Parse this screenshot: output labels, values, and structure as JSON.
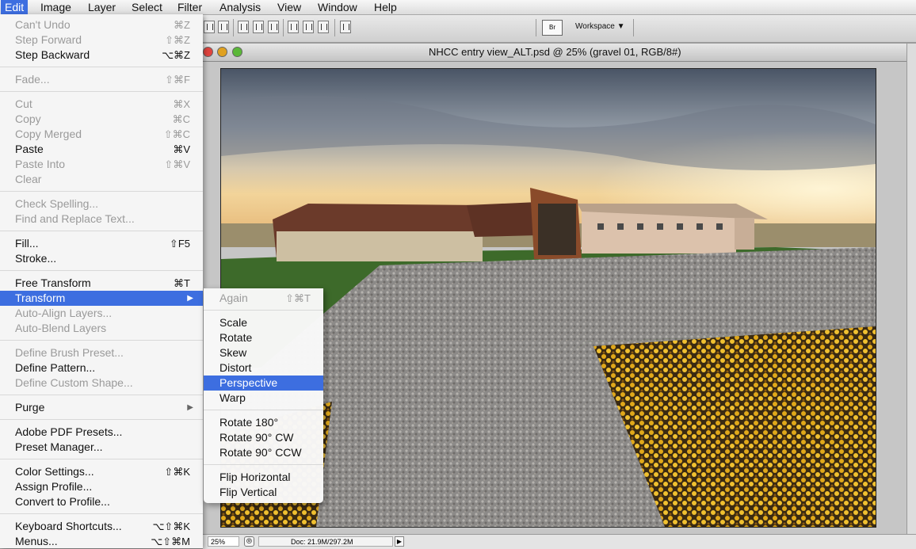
{
  "menubar": {
    "items": [
      "Edit",
      "Image",
      "Layer",
      "Select",
      "Filter",
      "Analysis",
      "View",
      "Window",
      "Help"
    ]
  },
  "toolbar": {
    "bridge_label": "Br",
    "workspace_label": "Workspace ▼"
  },
  "document": {
    "title": "NHCC entry view_ALT.psd @ 25% (gravel 01, RGB/8#)",
    "zoom": "25%",
    "doc_info": "Doc: 21.9M/297.2M"
  },
  "edit_menu": {
    "items": [
      {
        "label": "Can't Undo",
        "shortcut": "⌘Z",
        "disabled": true
      },
      {
        "label": "Step Forward",
        "shortcut": "⇧⌘Z",
        "disabled": true
      },
      {
        "label": "Step Backward",
        "shortcut": "⌥⌘Z",
        "disabled": false
      },
      {
        "label": "Fade...",
        "shortcut": "⇧⌘F",
        "disabled": true
      },
      {
        "label": "Cut",
        "shortcut": "⌘X",
        "disabled": true
      },
      {
        "label": "Copy",
        "shortcut": "⌘C",
        "disabled": true
      },
      {
        "label": "Copy Merged",
        "shortcut": "⇧⌘C",
        "disabled": true
      },
      {
        "label": "Paste",
        "shortcut": "⌘V",
        "disabled": false
      },
      {
        "label": "Paste Into",
        "shortcut": "⇧⌘V",
        "disabled": true
      },
      {
        "label": "Clear",
        "shortcut": "",
        "disabled": true
      },
      {
        "label": "Check Spelling...",
        "shortcut": "",
        "disabled": true
      },
      {
        "label": "Find and Replace Text...",
        "shortcut": "",
        "disabled": true
      },
      {
        "label": "Fill...",
        "shortcut": "⇧F5",
        "disabled": false
      },
      {
        "label": "Stroke...",
        "shortcut": "",
        "disabled": false
      },
      {
        "label": "Free Transform",
        "shortcut": "⌘T",
        "disabled": false
      },
      {
        "label": "Transform",
        "shortcut": "",
        "disabled": false
      },
      {
        "label": "Auto-Align Layers...",
        "shortcut": "",
        "disabled": true
      },
      {
        "label": "Auto-Blend Layers",
        "shortcut": "",
        "disabled": true
      },
      {
        "label": "Define Brush Preset...",
        "shortcut": "",
        "disabled": true
      },
      {
        "label": "Define Pattern...",
        "shortcut": "",
        "disabled": false
      },
      {
        "label": "Define Custom Shape...",
        "shortcut": "",
        "disabled": true
      },
      {
        "label": "Purge",
        "shortcut": "",
        "disabled": false
      },
      {
        "label": "Adobe PDF Presets...",
        "shortcut": "",
        "disabled": false
      },
      {
        "label": "Preset Manager...",
        "shortcut": "",
        "disabled": false
      },
      {
        "label": "Color Settings...",
        "shortcut": "⇧⌘K",
        "disabled": false
      },
      {
        "label": "Assign Profile...",
        "shortcut": "",
        "disabled": false
      },
      {
        "label": "Convert to Profile...",
        "shortcut": "",
        "disabled": false
      },
      {
        "label": "Keyboard Shortcuts...",
        "shortcut": "⌥⇧⌘K",
        "disabled": false
      },
      {
        "label": "Menus...",
        "shortcut": "⌥⇧⌘M",
        "disabled": false
      }
    ]
  },
  "transform_submenu": {
    "items": [
      {
        "label": "Again",
        "shortcut": "⇧⌘T",
        "disabled": true
      },
      {
        "label": "Scale",
        "shortcut": "",
        "disabled": false
      },
      {
        "label": "Rotate",
        "shortcut": "",
        "disabled": false
      },
      {
        "label": "Skew",
        "shortcut": "",
        "disabled": false
      },
      {
        "label": "Distort",
        "shortcut": "",
        "disabled": false
      },
      {
        "label": "Perspective",
        "shortcut": "",
        "disabled": false
      },
      {
        "label": "Warp",
        "shortcut": "",
        "disabled": false
      },
      {
        "label": "Rotate 180°",
        "shortcut": "",
        "disabled": false
      },
      {
        "label": "Rotate 90° CW",
        "shortcut": "",
        "disabled": false
      },
      {
        "label": "Rotate 90° CCW",
        "shortcut": "",
        "disabled": false
      },
      {
        "label": "Flip Horizontal",
        "shortcut": "",
        "disabled": false
      },
      {
        "label": "Flip Vertical",
        "shortcut": "",
        "disabled": false
      }
    ]
  },
  "colors": {
    "highlight": "#3d6ee0",
    "close": "#e0443e",
    "minimize": "#e0a120",
    "zoom": "#5bb838"
  }
}
